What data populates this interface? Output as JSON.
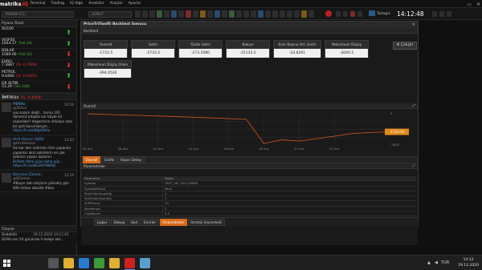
{
  "app": {
    "logo_main": "matriks",
    "logo_accent": "IQ",
    "menu": [
      "Terminal",
      "Trading",
      "IQ Algo",
      "Analizler",
      "Araçlar",
      "Ayarlar"
    ],
    "window_controls": [
      "▭",
      "✕"
    ]
  },
  "toolbar": {
    "left_field": "YARDIM (F1)",
    "symbol_field": "XEMUT",
    "user_label": "Tadagis",
    "clock": "14:12:48",
    "colors": {
      "alert": "#c02020",
      "accent": "#d86a1a"
    }
  },
  "market_watch": {
    "title": "Piyasa Özeti",
    "items": [
      {
        "name": "XU100",
        "price": "1444.17",
        "change": "(%0.24)",
        "direction": "up",
        "arrow": "⬆"
      },
      {
        "name": "VIOP30",
        "price": "1589.00",
        "change": "(%0.32)",
        "direction": "up",
        "arrow": "⬆"
      },
      {
        "name": "DOLAR",
        "price": "7.3887",
        "change": "(% -0.7808)",
        "direction": "down",
        "arrow": "⬇"
      },
      {
        "name": "EURO",
        "price": "9.0460",
        "change": "(% -0.6462)",
        "direction": "down",
        "arrow": "⬇"
      },
      {
        "name": "PETROL",
        "price": "51.29",
        "change": "(%1.184)",
        "direction": "up",
        "arrow": "⬆"
      },
      {
        "name": "GR ALTIN",
        "price": "446.1584",
        "change": "(% -0.4908)",
        "direction": "down",
        "arrow": "⬇"
      }
    ]
  },
  "twitter": {
    "title": "Twitter",
    "tweets": [
      {
        "name": "MENNU",
        "handle": "@Zkhon",
        "time": "12:56",
        "text": "yoo kazım değil... borsa 101 derseniz kitapta var böyle mi söylediler? değerlerce oldukçe olan bir şart kurumlarıyın…",
        "link": "https://t.co/oB4pOXAa"
      },
      {
        "name": "Hisit Hisseci (SOS)",
        "hasNamed": "@HisitHisseci",
        "handle": "@HisitHisseci",
        "time": "13:30",
        "text": "Siz kar den indirimin tüm yapanlar yapanlar aksi sakinlerin en çok şeklinin yapan kazanın.",
        "link": "Birlikte daha iyiye daha güç… https://t.co/dELUH7AKMQ"
      },
      {
        "name": "Borsanın Zamanı",
        "handle": "@BZaman",
        "time": "12:19",
        "text": "#Bayer dalı ahşların yükseliş gün 400 mihon absaldı #bos.",
        "link": ""
      }
    ]
  },
  "olaylar": {
    "title": "Olaylar",
    "rows": [
      {
        "label": "Dedektör",
        "time": "29.12.2020 14:12:45"
      },
      {
        "label": "DOAS son 20 gününde  A koleje aklı…",
        "time": ""
      }
    ]
  },
  "report": {
    "title": "PriceTriTwofit Backtest Sonucu",
    "backtest_header": "Backtest",
    "calculate_button": "Çalıştır",
    "stats": [
      {
        "label": "Overall",
        "value": "-1733.5"
      },
      {
        "label": "Getiri",
        "value": "-2733.5"
      },
      {
        "label": "Yüzde Getiri",
        "value": "-273.3580"
      },
      {
        "label": "Bakiye",
        "value": "-25133.5"
      },
      {
        "label": "Emir Başına Ort. Getiri",
        "value": "-24.8261"
      },
      {
        "label": "Maksimum Düşüş",
        "value": "-3040.5"
      },
      {
        "label": "Maksimum Düşüş Oranı",
        "value": "-394.0530"
      }
    ],
    "chart_header": "Overall",
    "tabs": [
      {
        "label": "Overall",
        "active": true
      },
      {
        "label": "Grafik",
        "active": false
      },
      {
        "label": "Rapor Detay",
        "active": false
      }
    ],
    "params_header": "Parametreler",
    "params": [
      {
        "k": "Parametre",
        "v": "Değer"
      },
      {
        "k": "Symbol",
        "v": "TEST_VIP_USD_EMIDE"
      },
      {
        "k": "SymbolPeriod",
        "v": "Min5"
      },
      {
        "k": "BuyOrderQuantity",
        "v": "1"
      },
      {
        "k": "SellOrderQuantity",
        "v": "1"
      },
      {
        "k": "ATRPeriod",
        "v": "10"
      },
      {
        "k": "MovPeriod",
        "v": "2"
      },
      {
        "k": "CoefBacon",
        "v": "4.5"
      },
      {
        "k": "MovMethod",
        "v": "Wilders"
      }
    ],
    "bottom_tabs": [
      {
        "label": "Loglar",
        "active": false
      },
      {
        "label": "Debug",
        "active": false
      },
      {
        "label": "Kod",
        "active": false
      },
      {
        "label": "Emirler",
        "active": false
      },
      {
        "label": "Parametreler",
        "active": true
      },
      {
        "label": "Strateji Seçmelekli",
        "active": false
      }
    ]
  },
  "chart_data": {
    "type": "line",
    "x": [
      "04 Ara",
      "07 Ara",
      "08 Ara",
      "09 Ara",
      "10 Ara",
      "11 Ara",
      "14 Ara",
      "15 Ara",
      "16 Ara",
      "17 Ara",
      "18 Ara",
      "21 Ara",
      "22 Ara",
      "23 Ara",
      "24 Ara",
      "25 Ara",
      "28 Ara",
      "29 Ara"
    ],
    "series": [
      {
        "values": [
          0,
          -60,
          -110,
          -160,
          -220,
          -270,
          -330,
          -400,
          -470,
          -520,
          -2850,
          -2500,
          -2620,
          -2400,
          -2150,
          -1900,
          -1800,
          -1733.5
        ]
      }
    ],
    "x_tick_labels": [
      "04 Ara",
      "08 Ara",
      "10 Ara",
      "14 Ara",
      "16 Ara",
      "18 Ara",
      "22 Ara",
      "24 Ara"
    ],
    "y_tick_labels": [
      "0",
      "-3000"
    ],
    "last_value_label": "-1733.50",
    "ylim": [
      -3000,
      0
    ],
    "line_color": "#c0521a",
    "grid": true
  },
  "taskbar": {
    "time": "14:12",
    "date": "29.12.2020",
    "tray_lang": "TUR",
    "apps": [
      {
        "name": "task-view",
        "color": "#555"
      },
      {
        "name": "explorer",
        "color": "#e0b030"
      },
      {
        "name": "edge",
        "color": "#2a7ad0"
      },
      {
        "name": "chrome",
        "color": "#3a9a3a"
      },
      {
        "name": "files",
        "color": "#e0b030"
      },
      {
        "name": "matriks",
        "color": "#d02020"
      },
      {
        "name": "sound",
        "color": "#5a9ed0"
      }
    ]
  }
}
